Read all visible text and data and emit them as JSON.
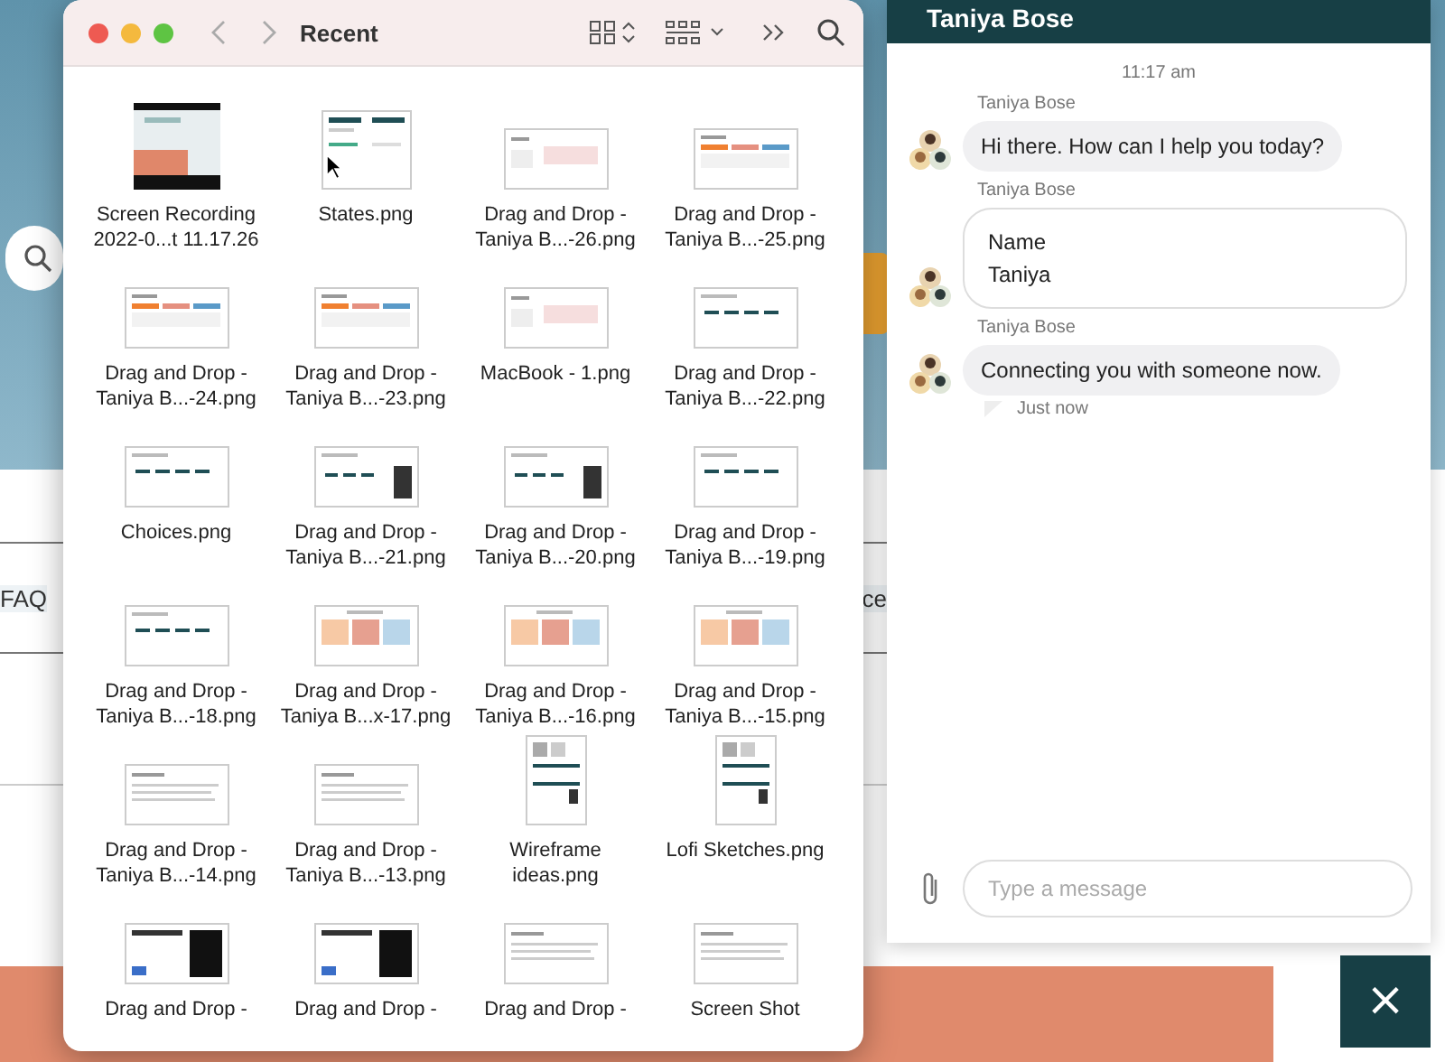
{
  "website": {
    "search": {
      "kind": "search"
    },
    "nav_items": [
      "FAQ",
      "ce"
    ]
  },
  "finder": {
    "title": "Recent",
    "files": [
      {
        "name": "Screen Recording 2022-0...t 11.17.26",
        "kind": "video"
      },
      {
        "name": "States.png",
        "kind": "page"
      },
      {
        "name": "Drag and Drop - Taniya B...-26.png",
        "kind": "chart"
      },
      {
        "name": "Drag and Drop - Taniya B...-25.png",
        "kind": "slides"
      },
      {
        "name": "Drag and Drop - Taniya B...-24.png",
        "kind": "slides"
      },
      {
        "name": "Drag and Drop - Taniya B...-23.png",
        "kind": "slides"
      },
      {
        "name": "MacBook - 1.png",
        "kind": "chart"
      },
      {
        "name": "Drag and Drop - Taniya B...-22.png",
        "kind": "steps"
      },
      {
        "name": "Choices.png",
        "kind": "steps"
      },
      {
        "name": "Drag and Drop - Taniya B...-21.png",
        "kind": "phone"
      },
      {
        "name": "Drag and Drop - Taniya B...-20.png",
        "kind": "phone"
      },
      {
        "name": "Drag and Drop - Taniya B...-19.png",
        "kind": "steps"
      },
      {
        "name": "Drag and Drop - Taniya B...-18.png",
        "kind": "steps"
      },
      {
        "name": "Drag and Drop - Taniya B...x-17.png",
        "kind": "cards"
      },
      {
        "name": "Drag and Drop - Taniya B...-16.png",
        "kind": "cards"
      },
      {
        "name": "Drag and Drop - Taniya B...-15.png",
        "kind": "cards"
      },
      {
        "name": "Drag and Drop - Taniya B...-14.png",
        "kind": "text"
      },
      {
        "name": "Drag and Drop - Taniya B...-13.png",
        "kind": "text"
      },
      {
        "name": "Wireframe ideas.png",
        "kind": "portrait"
      },
      {
        "name": "Lofi Sketches.png",
        "kind": "portrait"
      },
      {
        "name": "Drag and Drop -",
        "kind": "dark"
      },
      {
        "name": "Drag and Drop -",
        "kind": "dark"
      },
      {
        "name": "Drag and Drop -",
        "kind": "text"
      },
      {
        "name": "Screen Shot",
        "kind": "text"
      }
    ]
  },
  "chat": {
    "header": "Taniya Bose",
    "timestamp": "11:17 am",
    "messages": [
      {
        "sender": "Taniya Bose",
        "kind": "bubble",
        "text": "Hi there. How can I help you today?"
      },
      {
        "sender": "Taniya Bose",
        "kind": "card",
        "label": "Name",
        "value": "Taniya"
      },
      {
        "sender": "Taniya Bose",
        "kind": "bubble",
        "text": "Connecting you with someone now.",
        "status": "Just now"
      }
    ],
    "input": {
      "placeholder": "Type a message"
    },
    "close": {
      "symbol": "×"
    }
  }
}
